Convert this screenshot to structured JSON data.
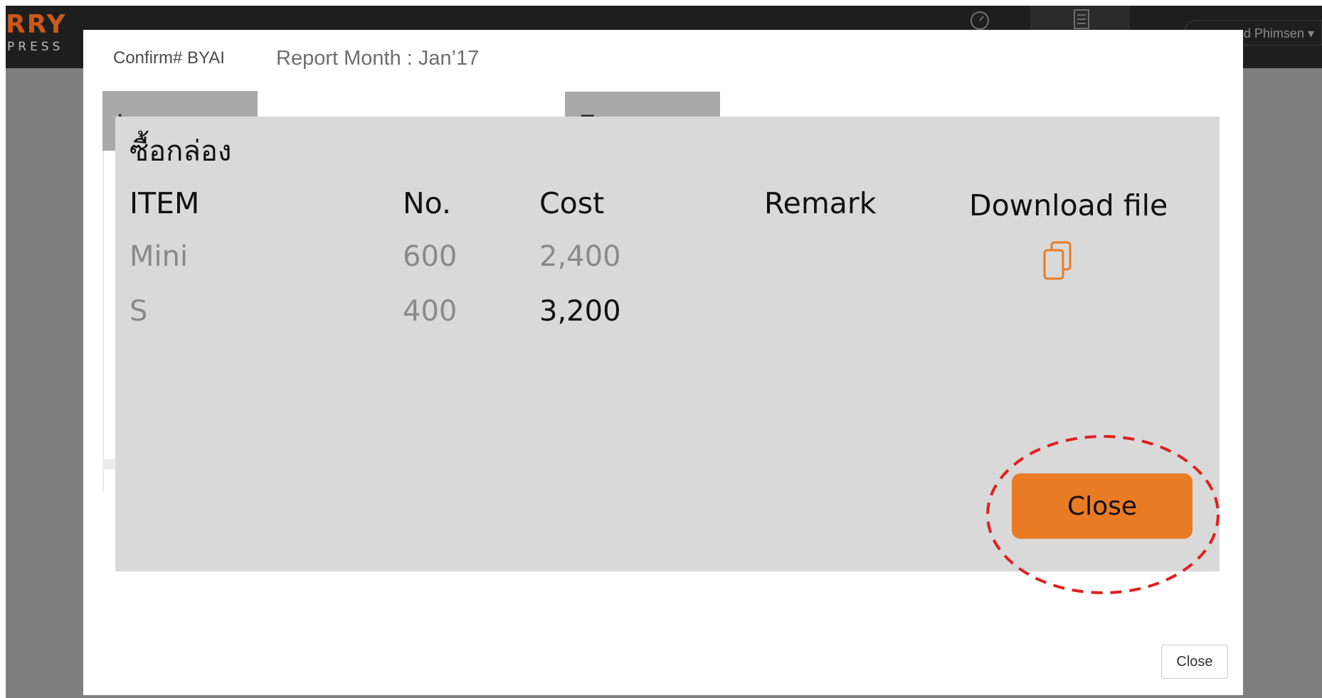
{
  "app": {
    "logo_top": "RRY",
    "logo_sub": "PRESS",
    "user_name": "d Phimsen ▾"
  },
  "modal": {
    "confirm_label": "Confirm# BYAI",
    "report_month": "Report Month : Jan’17",
    "tabs": [
      {
        "label": "Income"
      },
      {
        "label": "Expense"
      }
    ],
    "footer_close_label": "Close"
  },
  "popup": {
    "title": "ซื้อกล่อง",
    "columns": [
      "ITEM",
      "No.",
      "Cost",
      "Remark",
      "Download file"
    ],
    "rows": [
      {
        "item": "Mini",
        "no": "600",
        "cost": "2,400",
        "remark": ""
      },
      {
        "item": "S",
        "no": "400",
        "cost": "3,200",
        "remark": ""
      }
    ],
    "download_icon": "copy-icon",
    "close_label": "Close"
  },
  "colors": {
    "accent": "#e97b24",
    "popup_bg": "#d9d9d9",
    "highlight_ring": "#e0201f",
    "backdrop": "#7f7f7f",
    "navbar": "#1e1e1e"
  }
}
